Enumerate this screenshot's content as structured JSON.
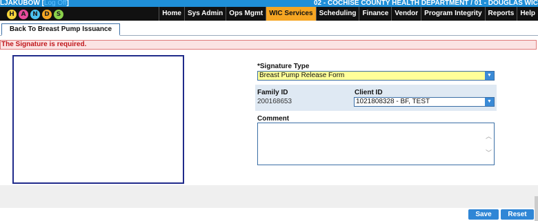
{
  "header": {
    "user": "LJAKUBOW",
    "logout_label": "Log Off",
    "department": "02 - COCHISE COUNTY HEALTH DEPARTMENT / 01 - DOUGLAS WIC"
  },
  "logo": {
    "letters": [
      "H",
      "A",
      "N",
      "D",
      "S"
    ],
    "colors": [
      "#f5d33a",
      "#e94b9c",
      "#4bc2ef",
      "#f6a623",
      "#8bd14b"
    ]
  },
  "nav": {
    "items": [
      {
        "label": "Home",
        "active": false
      },
      {
        "label": "Sys Admin",
        "active": false
      },
      {
        "label": "Ops Mgmt",
        "active": false
      },
      {
        "label": "WIC Services",
        "active": true
      },
      {
        "label": "Scheduling",
        "active": false
      },
      {
        "label": "Finance",
        "active": false
      },
      {
        "label": "Vendor",
        "active": false
      },
      {
        "label": "Program Integrity",
        "active": false
      },
      {
        "label": "Reports",
        "active": false
      },
      {
        "label": "Help",
        "active": false
      }
    ]
  },
  "back_button_label": "Back To Breast Pump Issuance",
  "error_message": "The Signature is required.",
  "form": {
    "signature_type_label": "*Signature Type",
    "signature_type_value": "Breast Pump Release Form",
    "family_id_label": "Family ID",
    "family_id_value": "200168653",
    "client_id_label": "Client ID",
    "client_id_value": "1021808328 - BF, TEST",
    "comment_label": "Comment",
    "comment_value": ""
  },
  "actions": {
    "save_label": "Save",
    "reset_label": "Reset"
  },
  "colors": {
    "header_blue": "#1f8fd8",
    "nav_active": "#f6a623",
    "error_text": "#c0171c",
    "select_highlight": "#ffff99",
    "button_blue": "#2f86d6"
  }
}
